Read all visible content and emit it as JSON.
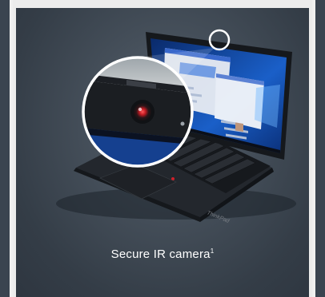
{
  "feature": {
    "caption": "Secure IR camera",
    "footnote_mark": "1",
    "brand_mark": "ThinkPad"
  },
  "colors": {
    "card_background": "#3d4650",
    "caption_text": "#ffffff",
    "camera_led": "#e0303a"
  },
  "icons": [
    "laptop-image",
    "webcam-highlight-circle",
    "magnified-camera-lens"
  ]
}
